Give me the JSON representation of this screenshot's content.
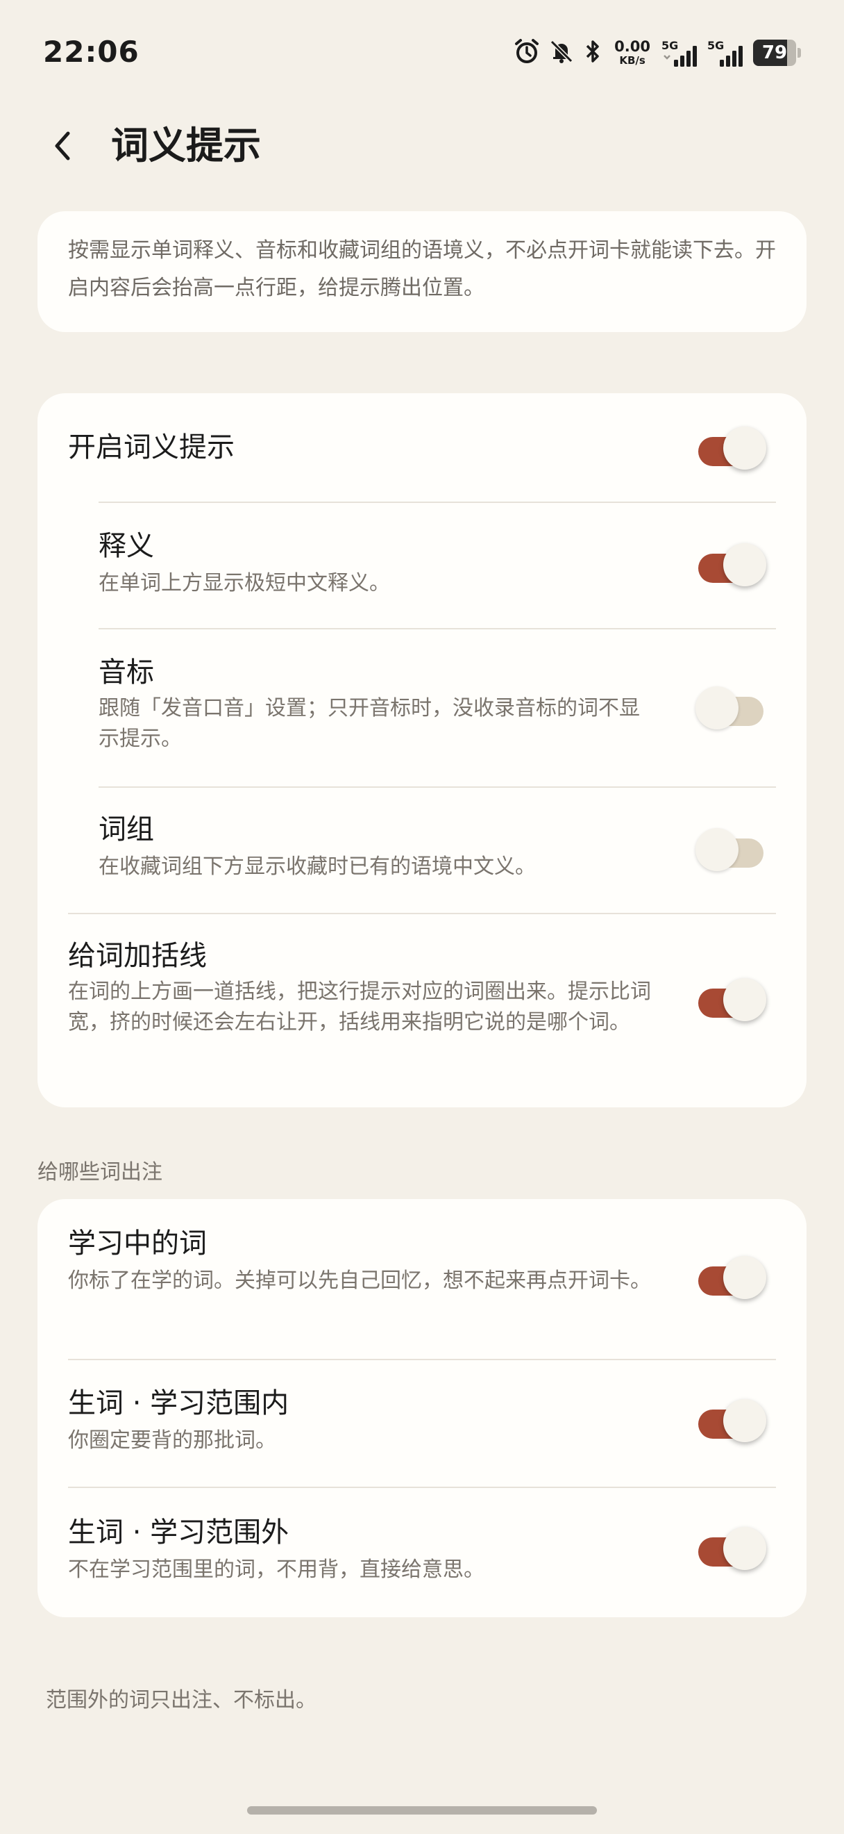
{
  "status_bar": {
    "time": "22:06",
    "net_speed_value": "0.00",
    "net_speed_unit": "KB/s",
    "signal_1_label": "5G",
    "signal_2_label": "5G",
    "battery_level": "79"
  },
  "header": {
    "title": "词义提示"
  },
  "intro": {
    "text": "按需显示单词释义、音标和收藏词组的语境义，不必点开词卡就能读下去。开启内容后会抬高一点行距，给提示腾出位置。"
  },
  "settings": {
    "enable": {
      "title": "开启词义提示",
      "on": true
    },
    "meaning": {
      "title": "释义",
      "desc": "在单词上方显示极短中文释义。",
      "on": true
    },
    "phonetic": {
      "title": "音标",
      "desc": "跟随「发音口音」设置；只开音标时，没收录音标的词不显示提示。",
      "on": false
    },
    "phrase": {
      "title": "词组",
      "desc": "在收藏词组下方显示收藏时已有的语境中文义。",
      "on": false
    },
    "bracket": {
      "title": "给词加括线",
      "desc": "在词的上方画一道括线，把这行提示对应的词圈出来。提示比词宽，挤的时候还会左右让开，括线用来指明它说的是哪个词。",
      "on": true
    }
  },
  "words_section": {
    "label": "给哪些词出注",
    "learning": {
      "title": "学习中的词",
      "desc": "你标了在学的词。关掉可以先自己回忆，想不起来再点开词卡。",
      "on": true
    },
    "new_in_scope": {
      "title": "生词 · 学习范围内",
      "desc": "你圈定要背的那批词。",
      "on": true
    },
    "new_out_scope": {
      "title": "生词 · 学习范围外",
      "desc": "不在学习范围里的词，不用背，直接给意思。",
      "on": true
    }
  },
  "footer": {
    "note": "范围外的词只出注、不标出。"
  },
  "colors": {
    "background": "#f4f0e8",
    "card": "#fffefb",
    "toggle_on": "#a84a34",
    "toggle_off": "#ddd3c0"
  }
}
